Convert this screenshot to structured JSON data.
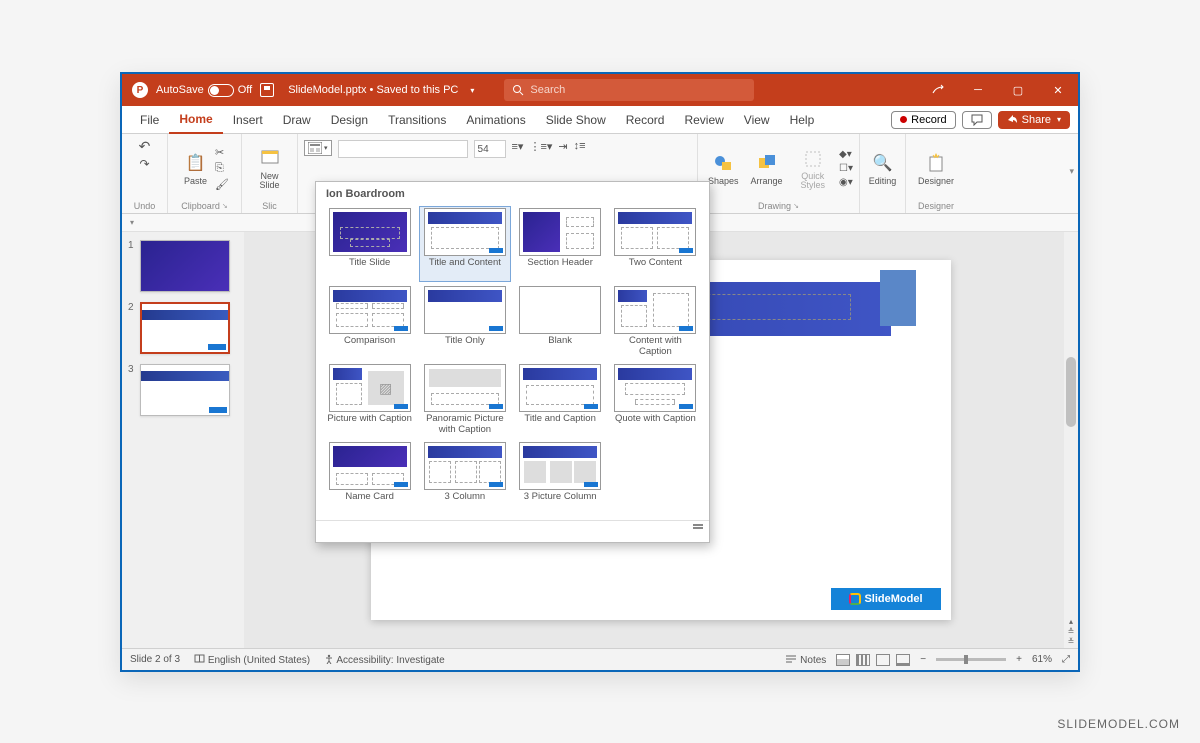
{
  "titlebar": {
    "autosave_label": "AutoSave",
    "autosave_state": "Off",
    "filename": "SlideModel.pptx",
    "save_status": "Saved to this PC",
    "search_placeholder": "Search"
  },
  "menus": [
    "File",
    "Home",
    "Insert",
    "Draw",
    "Design",
    "Transitions",
    "Animations",
    "Slide Show",
    "Record",
    "Review",
    "View",
    "Help"
  ],
  "menu_active": "Home",
  "menu_right": {
    "record": "Record",
    "share": "Share"
  },
  "ribbon": {
    "undo": "Undo",
    "clipboard": "Clipboard",
    "paste": "Paste",
    "slides_group": "Slic",
    "new_slide": "New Slide",
    "font_size": "54",
    "drawing": "Drawing",
    "shapes": "Shapes",
    "arrange": "Arrange",
    "quick_styles": "Quick Styles",
    "editing": "Editing",
    "designer_btn": "Designer",
    "designer_group": "Designer"
  },
  "gallery": {
    "theme": "Ion Boardroom",
    "layouts": [
      "Title Slide",
      "Title and Content",
      "Section Header",
      "Two Content",
      "Comparison",
      "Title Only",
      "Blank",
      "Content with Caption",
      "Picture with Caption",
      "Panoramic Picture with Caption",
      "Title and Caption",
      "Quote with Caption",
      "Name Card",
      "3 Column",
      "3 Picture Column"
    ],
    "hovered": 1
  },
  "thumbnails": [
    1,
    2,
    3
  ],
  "selected_slide": 2,
  "slide_logo": "SlideModel",
  "statusbar": {
    "slide_pos": "Slide 2 of 3",
    "language": "English (United States)",
    "accessibility": "Accessibility: Investigate",
    "notes": "Notes",
    "zoom": "61%"
  },
  "watermark": "SLIDEMODEL.COM"
}
